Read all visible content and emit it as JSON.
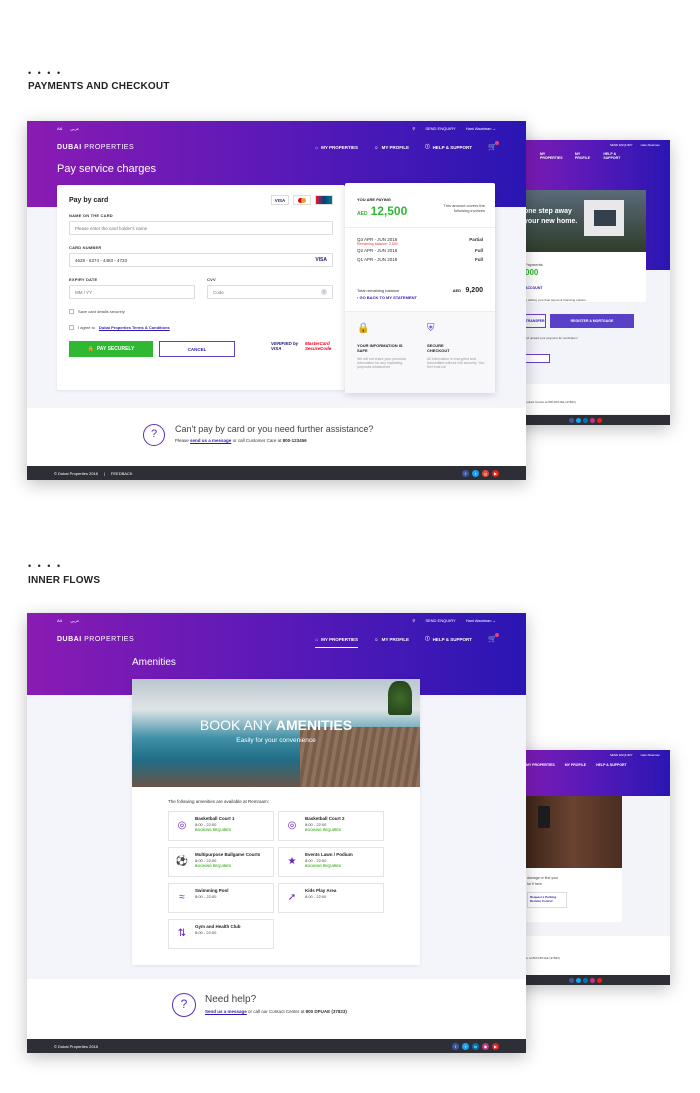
{
  "sections": {
    "dots": "• • • •",
    "payments_title": "PAYMENTS AND CHECKOUT",
    "inner_title": "INNER FLOWS"
  },
  "colors": {
    "brand_purple": "#8a1bb3",
    "brand_blue": "#2a16b3",
    "pay_green": "#2fb832",
    "footer_dark": "#2e2f36",
    "link_blue": "#2b1bb0"
  },
  "header": {
    "font_toggle": "AA",
    "lang": "عربي",
    "send_enquiry": "SEND ENQUIRY",
    "user_name": "Hani Alsatman",
    "logo_main": "DUBAI",
    "logo_sub": "PROPERTIES",
    "nav": [
      "MY PROPERTIES",
      "MY PROFILE",
      "HELP & SUPPORT"
    ],
    "icons": [
      "search-icon",
      "chevron-down-icon",
      "home-icon",
      "user-icon",
      "help-icon",
      "cart-icon"
    ]
  },
  "payment": {
    "page_title": "Pay service charges",
    "card_title": "Pay by card",
    "card_brands": [
      "VISA",
      "MC",
      "DinersClub"
    ],
    "name_label": "NAME ON THE CARD",
    "name_placeholder": "Please enter the card holder's name",
    "number_label": "CARD NUMBER",
    "number_value": "4628 - 6374 - 4483 - 4733",
    "number_brand": "VISA",
    "expiry_label": "EXPIRY DATE",
    "expiry_placeholder": "MM / YY",
    "cvv_label": "CVV",
    "cvv_placeholder": "Code",
    "cvv_help": "?",
    "save_label": "Save card details securely",
    "terms_prefix": "I agree to",
    "terms_link": "Dubai Properties Terms & Conditions",
    "pay_button": "PAY SECURELY",
    "cancel_button": "CANCEL",
    "verified_by": "VERIFIED by VISA",
    "mc_secure": "MasterCard SecureCode"
  },
  "summary": {
    "paying_label": "YOU ARE PAYING",
    "currency": "AED",
    "amount": "12,500",
    "covers_text": "This amount covers the following invoices",
    "invoices": [
      {
        "period": "Q3 APR - JUN 2018",
        "status": "Partial",
        "note": "Remaining balance: 2,500"
      },
      {
        "period": "Q2 APR - JUN 2018",
        "status": "Full",
        "note": ""
      },
      {
        "period": "Q1 APR - JUN 2018",
        "status": "Full",
        "note": ""
      }
    ],
    "remaining_label": "Total remaining balance",
    "remaining_currency": "AED",
    "remaining_value": "9,200",
    "back_link": "GO BACK TO MY STATEMENT",
    "info_title": "YOUR INFORMATION IS SAFE",
    "info_text": "We will not share your personal information for any marketing purposes whatsoever",
    "secure_title": "SECURE CHECKOUT",
    "secure_text": "All information is encrypted and transmitted without risk securely. You feel trust us!"
  },
  "assist": {
    "title": "Can't pay by card or you need further assistance?",
    "prefix": "Please",
    "link": "send us a message",
    "middle": "or call Customer Care at",
    "phone": "800-123456"
  },
  "footer1": {
    "copyright": "© Dubai Properties 2018",
    "sep": "|",
    "feedback": "FEEDBACK"
  },
  "mobile1": {
    "hero_line1": "one step away",
    "hero_line2": "your new home.",
    "amount_frag": "000",
    "label_frag": "Payments",
    "link_frag": "ACCOUNT",
    "info_frag": "by adding your final payment financing options.",
    "btn_transfer": "TRANSFER",
    "btn_register": "REGISTER A MORTGAGE",
    "upload_text": "and upload your payment for verification",
    "footer_text": "Contact Centre at 800 DPUAE (37823)"
  },
  "amenities": {
    "page_title": "Amenities",
    "hero_title_light": "BOOK ANY",
    "hero_title_bold": "AMENITIES",
    "hero_sub": "Easily for your convenience",
    "intro": "The following amenities are available  at Remraam:",
    "items": [
      {
        "name": "Basketball Court 1",
        "hours": "8:00 - 22:00",
        "badge": "BOOKING REQUIRED"
      },
      {
        "name": "Basketball Court 2",
        "hours": "8:00 - 22:00",
        "badge": "BOOKING REQUIRED"
      },
      {
        "name": "Multipurpose Ballgame Courts",
        "hours": "8:00 - 22:00",
        "badge": "BOOKING REQUIRED"
      },
      {
        "name": "Events Lawn / Podium",
        "hours": "8:00 - 22:00",
        "badge": "BOOKING REQUIRED"
      },
      {
        "name": "Swimming Pool",
        "hours": "8:00 - 22:00",
        "badge": ""
      },
      {
        "name": "Kids Play Area",
        "hours": "8:00 - 22:00",
        "badge": ""
      },
      {
        "name": "Gym and Health Club",
        "hours": "8:00 - 22:00",
        "badge": ""
      }
    ],
    "help_title": "Need help?",
    "help_link": "Send us a message",
    "help_text": "or call our Contact Center at",
    "help_phone": "800 DPUAE (37823)"
  },
  "footer2": {
    "copyright": "© Dubai Properties 2018"
  },
  "mobile2": {
    "text1": "damage or find your",
    "text2": "far fi here.",
    "link_btn": "Request a Parking Remote Control",
    "footer_text": "tter at 800 DPUAE (37823)"
  }
}
